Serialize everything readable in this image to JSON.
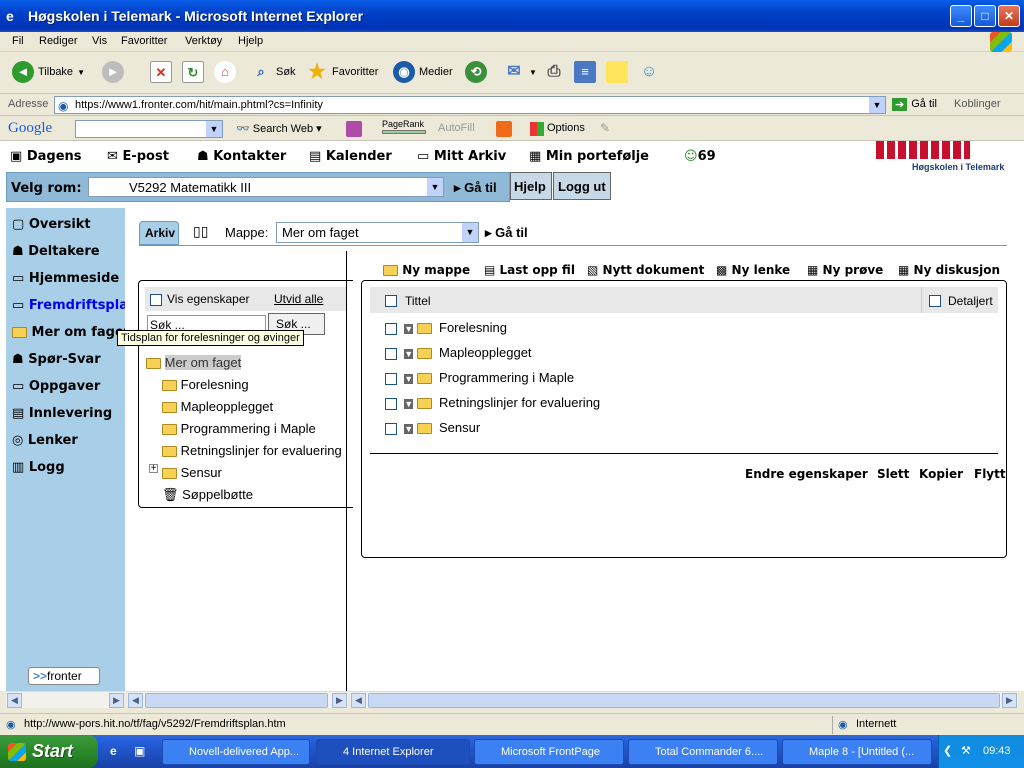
{
  "window": {
    "title": "Høgskolen i Telemark - Microsoft Internet Explorer"
  },
  "menu": [
    "Fil",
    "Rediger",
    "Vis",
    "Favoritter",
    "Verktøy",
    "Hjelp"
  ],
  "toolbar": {
    "back": "Tilbake",
    "search": "Søk",
    "favorites": "Favoritter",
    "media": "Medier"
  },
  "address": {
    "label": "Adresse",
    "url": "https://www1.fronter.com/hit/main.phtml?cs=Infinity",
    "go": "Gå til",
    "links": "Koblinger"
  },
  "google": {
    "logo": "Google",
    "search_web": "Search Web",
    "pagerank": "PageRank",
    "autofill": "AutoFill",
    "options": "Options"
  },
  "topnav": {
    "items": [
      "Dagens",
      "E-post",
      "Kontakter",
      "Kalender",
      "Mitt Arkiv",
      "Min portefølje"
    ],
    "count": "69",
    "school": "Høgskolen i Telemark"
  },
  "room": {
    "label": "Velg rom:",
    "selected": "V5292 Matematikk III",
    "go": "Gå til",
    "help": "Hjelp",
    "logout": "Logg ut"
  },
  "sidebar": {
    "items": [
      "Oversikt",
      "Deltakere",
      "Hjemmeside",
      "Fremdriftsplan",
      "Mer om faget",
      "Spør-Svar",
      "Oppgaver",
      "Innlevering",
      "Lenker",
      "Logg"
    ],
    "logo": "fronter"
  },
  "tooltip": "Tidsplan for forelesninger og øvinger",
  "archive": {
    "tab": "Arkiv",
    "folder_label": "Mappe:",
    "folder_value": "Mer om faget",
    "go": "Gå til"
  },
  "tree": {
    "show_props": "Vis egenskaper",
    "expand_all": "Utvid alle",
    "search_placeholder": "Søk ...",
    "search_btn": "Søk ...",
    "root": "Mer om faget",
    "children": [
      "Forelesning",
      "Mapleopplegget",
      "Programmering i Maple",
      "Retningslinjer for evaluering",
      "Sensur"
    ],
    "trash": "Søppelbøtte"
  },
  "actions": [
    "Ny mappe",
    "Last opp fil",
    "Nytt dokument",
    "Ny lenke",
    "Ny prøve",
    "Ny diskusjon"
  ],
  "list": {
    "col_title": "Tittel",
    "col_detail": "Detaljert",
    "rows": [
      "Forelesning",
      "Mapleopplegget",
      "Programmering i Maple",
      "Retningslinjer for evaluering",
      "Sensur"
    ]
  },
  "bottom_actions": [
    "Endre egenskaper",
    "Slett",
    "Kopier",
    "Flytt"
  ],
  "status": {
    "url": "http://www-pors.hit.no/tf/fag/v5292/Fremdriftsplan.htm",
    "zone": "Internett"
  },
  "taskbar": {
    "start": "Start",
    "tasks": [
      "Novell-delivered App...",
      "4 Internet Explorer",
      "Microsoft FrontPage",
      "Total Commander 6....",
      "Maple 8 - [Untitled (..."
    ],
    "clock": "09:43"
  },
  "colors": {
    "title_bar": "#0a5ee8",
    "sidebar": "#a9cfe8",
    "room_bar": "#8fb9d6",
    "link": "#0000ee"
  }
}
